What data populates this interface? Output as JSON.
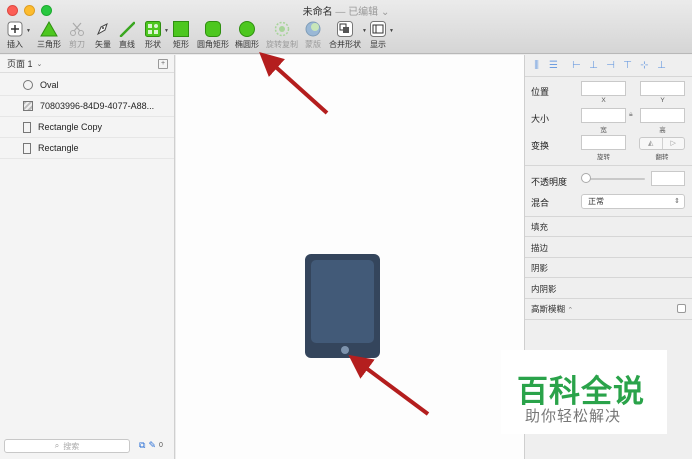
{
  "window": {
    "title": "未命名",
    "separator": "—",
    "edited_label": "已编辑",
    "chevron": "⌄"
  },
  "toolbar": {
    "items": [
      {
        "label": "插入",
        "icon": "plus-icon"
      },
      {
        "label": "三角形",
        "icon": "triangle-icon"
      },
      {
        "label": "剪刀",
        "icon": "scissors-icon"
      },
      {
        "label": "矢量",
        "icon": "vector-pen-icon"
      },
      {
        "label": "直线",
        "icon": "line-icon"
      },
      {
        "label": "形状",
        "icon": "shapes-icon"
      },
      {
        "label": "矩形",
        "icon": "rectangle-icon"
      },
      {
        "label": "圆角矩形",
        "icon": "rounded-rectangle-icon"
      },
      {
        "label": "椭圆形",
        "icon": "oval-icon"
      },
      {
        "label": "旋转复制",
        "icon": "rotate-copy-icon"
      },
      {
        "label": "蒙版",
        "icon": "mask-icon"
      },
      {
        "label": "合并形状",
        "icon": "combine-shapes-icon"
      },
      {
        "label": "显示",
        "icon": "view-icon"
      }
    ]
  },
  "pages": {
    "current": "页面 1",
    "chevron": "⌄",
    "add_icon": "+"
  },
  "layers": [
    {
      "name": "Oval",
      "icon": "oval-layer-icon"
    },
    {
      "name": "70803996-84D9-4077-A88...",
      "icon": "image-layer-icon"
    },
    {
      "name": "Rectangle Copy",
      "icon": "rectangle-layer-icon"
    },
    {
      "name": "Rectangle",
      "icon": "rectangle-layer-icon"
    }
  ],
  "layer_search": {
    "placeholder": "搜索",
    "count": "0"
  },
  "inspector": {
    "position_label": "位置",
    "x_label": "X",
    "y_label": "Y",
    "size_label": "大小",
    "width_label": "宽",
    "height_label": "高",
    "transform_label": "变换",
    "rotate_label": "旋转",
    "flip_label": "翻转",
    "opacity_label": "不透明度",
    "blend_label": "混合",
    "blend_value": "正常",
    "fill_label": "填充",
    "border_label": "描边",
    "shadow_label": "阴影",
    "inner_shadow_label": "内阴影",
    "blur_label": "高斯模糊",
    "blur_chevron": "⌃"
  },
  "canvas_object": {
    "body_color": "#34455c",
    "screen_color": "#425a78",
    "button_color": "#7d93ad"
  },
  "annotation": {
    "arrow_color": "#b41e1e"
  },
  "watermark": {
    "title": "百科全说",
    "subtitle": "助你轻松解决"
  },
  "colors": {
    "green_tool": "#4dc71f",
    "accent_blue": "#2a6fd6"
  }
}
